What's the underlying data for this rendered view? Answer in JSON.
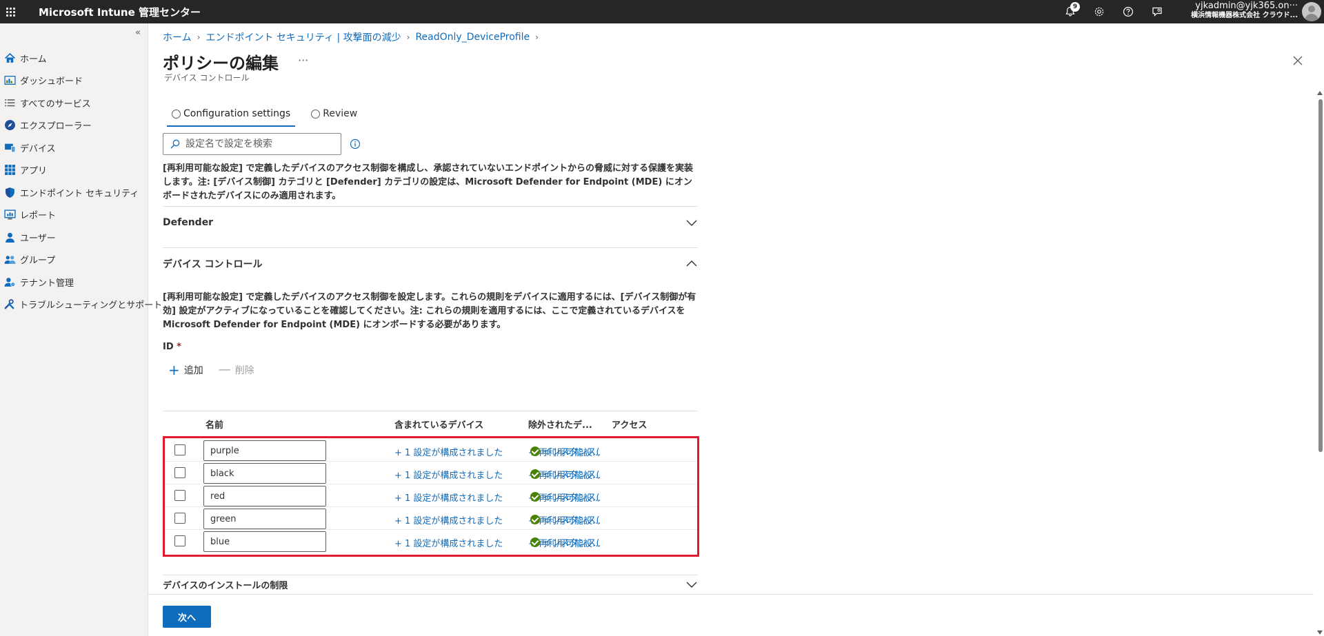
{
  "topbar": {
    "brand": "Microsoft Intune 管理センター",
    "notification_count": "9",
    "account_name": "yjkadmin@yjk365.on···",
    "account_org": "横浜情報機器株式会社 クラウド..."
  },
  "sidebar": {
    "collapse": "«",
    "items": [
      {
        "label": "ホーム",
        "icon": "home-icon"
      },
      {
        "label": "ダッシュボード",
        "icon": "dashboard-icon"
      },
      {
        "label": "すべてのサービス",
        "icon": "list-icon"
      },
      {
        "label": "エクスプローラー",
        "icon": "explorer-icon"
      },
      {
        "label": "デバイス",
        "icon": "device-icon"
      },
      {
        "label": "アプリ",
        "icon": "apps-grid-icon"
      },
      {
        "label": "エンドポイント セキュリティ",
        "icon": "shield-icon"
      },
      {
        "label": "レポート",
        "icon": "report-icon"
      },
      {
        "label": "ユーザー",
        "icon": "user-icon"
      },
      {
        "label": "グループ",
        "icon": "group-icon"
      },
      {
        "label": "テナント管理",
        "icon": "tenant-admin-icon"
      },
      {
        "label": "トラブルシューティングとサポート",
        "icon": "wrench-icon"
      }
    ]
  },
  "breadcrumb": [
    "ホーム",
    "エンドポイント セキュリティ | 攻撃面の減少",
    "ReadOnly_DeviceProfile"
  ],
  "page": {
    "title": "ポリシーの編集",
    "more": "···",
    "subtitle": "デバイス コントロール"
  },
  "tabs": [
    {
      "label": "Configuration settings",
      "active": true
    },
    {
      "label": "Review",
      "active": false
    }
  ],
  "search": {
    "placeholder": "設定名で設定を検索"
  },
  "description": "[再利用可能な設定] で定義したデバイスのアクセス制御を構成し、承認されていないエンドポイントからの脅威に対する保護を実装します。注: [デバイス制御] カテゴリと [Defender] カテゴリの設定は、Microsoft Defender for Endpoint (MDE) にオンボードされたデバイスにのみ適用されます。",
  "sections": {
    "defender": "Defender",
    "device_control": "デバイス コントロール",
    "install_restriction": "デバイスのインストールの制限"
  },
  "device_control": {
    "description": "[再利用可能な設定] で定義したデバイスのアクセス制御を設定します。これらの規則をデバイスに適用するには、[デバイス制御が有効] 設定がアクティブになっていることを確認してください。注: これらの規則を適用するには、ここで定義されているデバイスをMicrosoft Defender for Endpoint (MDE) にオンボードする必要があります。",
    "id_label": "ID",
    "required_mark": "*",
    "add": "追加",
    "delete": "削除",
    "columns": {
      "name": "名前",
      "included": "含まれているデバイス",
      "excluded": "除外されたデ...",
      "access": "アクセス"
    },
    "rows": [
      {
        "name": "purple",
        "included": "+ 1 設定が構成されました",
        "excluded": "+ 再利用可能設...",
        "access": "インスタンス("
      },
      {
        "name": "black",
        "included": "+ 1 設定が構成されました",
        "excluded": "+ 再利用可能設...",
        "access": "インスタンス("
      },
      {
        "name": "red",
        "included": "+ 1 設定が構成されました",
        "excluded": "+ 再利用可能設...",
        "access": "インスタンス("
      },
      {
        "name": "green",
        "included": "+ 1 設定が構成されました",
        "excluded": "+ 再利用可能設...",
        "access": "インスタンス("
      },
      {
        "name": "blue",
        "included": "+ 1 設定が構成されました",
        "excluded": "+ 再利用可能設...",
        "access": "インスタンス("
      }
    ]
  },
  "footer": {
    "next": "次へ"
  },
  "colors": {
    "accent": "#0f6cbd",
    "highlight_border": "#e0192d",
    "success": "#498205",
    "topbar": "#262626"
  }
}
